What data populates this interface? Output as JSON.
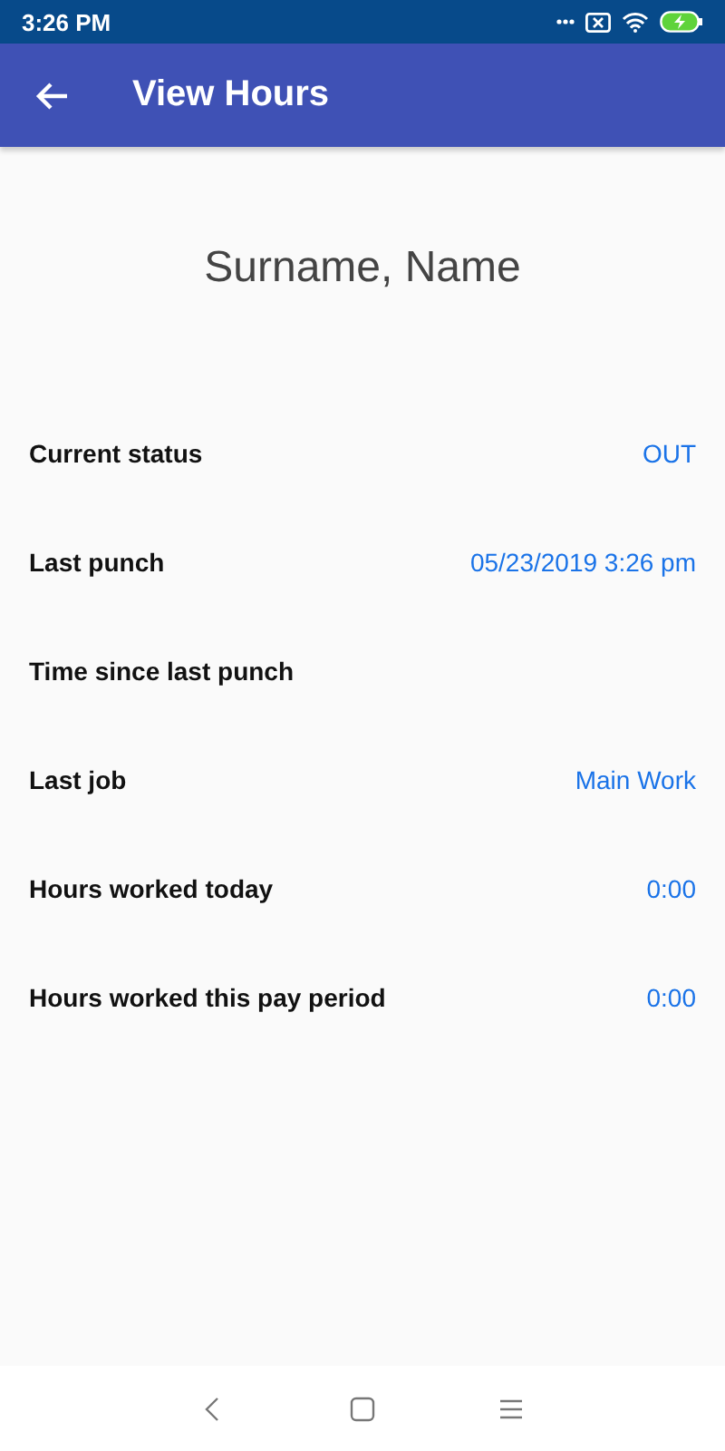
{
  "status_bar": {
    "time": "3:26 PM"
  },
  "app_bar": {
    "title": "View Hours"
  },
  "employee_name": "Surname, Name",
  "rows": [
    {
      "label": "Current status",
      "value": "OUT"
    },
    {
      "label": "Last punch",
      "value": "05/23/2019 3:26 pm"
    },
    {
      "label": "Time since last punch"
    },
    {
      "label": "Last job",
      "value": "Main Work"
    },
    {
      "label": "Hours worked today",
      "value": "0:00"
    },
    {
      "label": "Hours worked this pay period",
      "value": "0:00"
    }
  ]
}
